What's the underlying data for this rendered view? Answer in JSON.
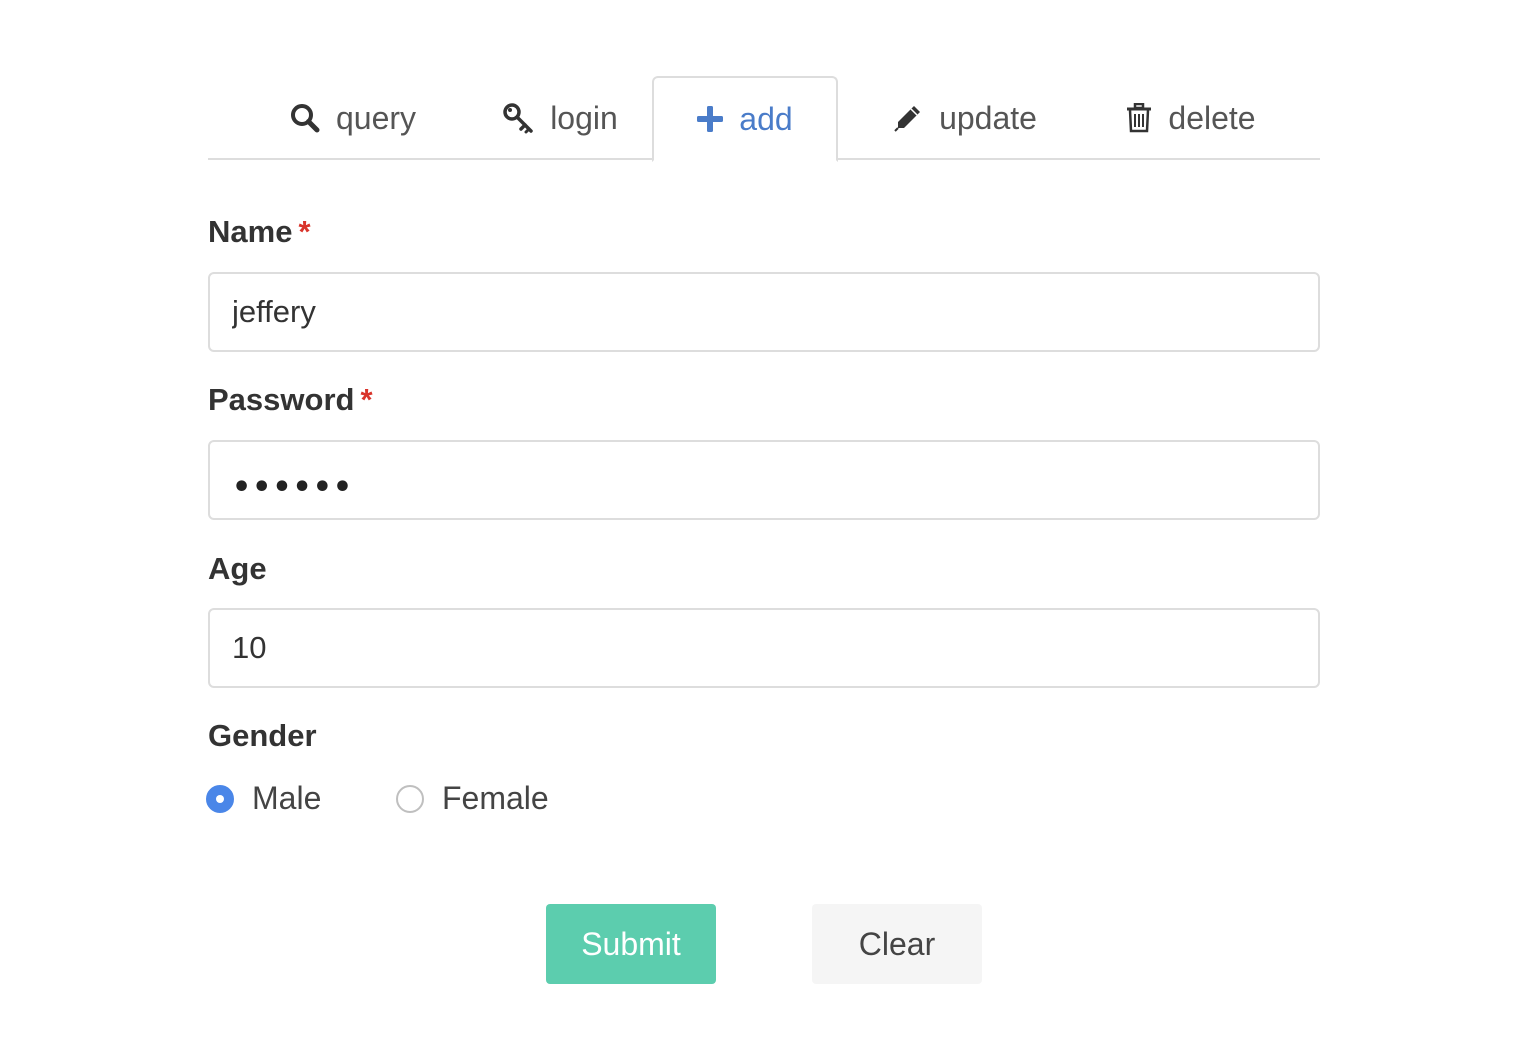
{
  "tabs": [
    {
      "label": "query",
      "icon": "search-icon"
    },
    {
      "label": "login",
      "icon": "key-icon"
    },
    {
      "label": "add",
      "icon": "plus-icon",
      "active": true
    },
    {
      "label": "update",
      "icon": "pencil-icon"
    },
    {
      "label": "delete",
      "icon": "trash-icon"
    }
  ],
  "form": {
    "name": {
      "label": "Name",
      "required_mark": "*",
      "value": "jeffery"
    },
    "password": {
      "label": "Password",
      "required_mark": "*",
      "masked_value": "••••••"
    },
    "age": {
      "label": "Age",
      "value": "10"
    },
    "gender": {
      "label": "Gender",
      "options": [
        {
          "label": "Male",
          "checked": true
        },
        {
          "label": "Female",
          "checked": false
        }
      ]
    }
  },
  "buttons": {
    "submit_label": "Submit",
    "clear_label": "Clear"
  },
  "colors": {
    "accent_blue": "#4a7cc9",
    "submit_green": "#5ccdae",
    "required_red": "#d9342b",
    "radio_blue": "#4a86e8"
  }
}
